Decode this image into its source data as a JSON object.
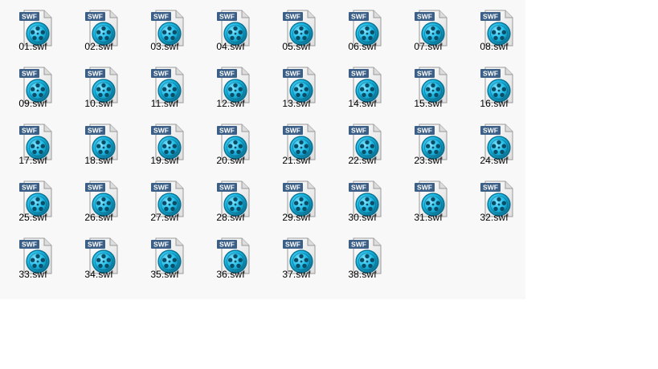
{
  "icon_type_text": "SWF",
  "icon_semantic": "swf-file-icon",
  "colors": {
    "background": "#ffffff",
    "pane_background": "#f8f8f8",
    "page_fill": "#f4f4f4",
    "fold": "#dcdcdc",
    "badge": "#3b5f86",
    "disc_outer": "#0a6e8e",
    "disc_inner": "#18b7e3",
    "label_text": "#000000"
  },
  "files": [
    {
      "name": "01.swf"
    },
    {
      "name": "02.swf"
    },
    {
      "name": "03.swf"
    },
    {
      "name": "04.swf"
    },
    {
      "name": "05.swf"
    },
    {
      "name": "06.swf"
    },
    {
      "name": "07.swf"
    },
    {
      "name": "08.swf"
    },
    {
      "name": "09.swf"
    },
    {
      "name": "10.swf"
    },
    {
      "name": "11.swf"
    },
    {
      "name": "12.swf"
    },
    {
      "name": "13.swf"
    },
    {
      "name": "14.swf"
    },
    {
      "name": "15.swf"
    },
    {
      "name": "16.swf"
    },
    {
      "name": "17.swf"
    },
    {
      "name": "18.swf"
    },
    {
      "name": "19.swf"
    },
    {
      "name": "20.swf"
    },
    {
      "name": "21.swf"
    },
    {
      "name": "22.swf"
    },
    {
      "name": "23.swf"
    },
    {
      "name": "24.swf"
    },
    {
      "name": "25.swf"
    },
    {
      "name": "26.swf"
    },
    {
      "name": "27.swf"
    },
    {
      "name": "28.swf"
    },
    {
      "name": "29.swf"
    },
    {
      "name": "30.swf"
    },
    {
      "name": "31.swf"
    },
    {
      "name": "32.swf"
    },
    {
      "name": "33.swf"
    },
    {
      "name": "34.swf"
    },
    {
      "name": "35.swf"
    },
    {
      "name": "36.swf"
    },
    {
      "name": "37.swf"
    },
    {
      "name": "38.swf"
    }
  ]
}
